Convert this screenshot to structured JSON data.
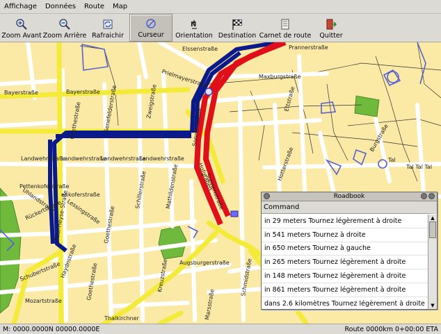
{
  "menu": [
    "Affichage",
    "Données",
    "Route",
    "Map"
  ],
  "toolbar": [
    {
      "label": "Zoom Avant",
      "icon": "zoom-in-icon"
    },
    {
      "label": "Zoom Arrière",
      "icon": "zoom-out-icon"
    },
    {
      "label": "Rafraichir",
      "icon": "refresh-icon"
    },
    {
      "label": "Curseur",
      "icon": "cursor-icon"
    },
    {
      "label": "Orientation",
      "icon": "compass-icon"
    },
    {
      "label": "Destination",
      "icon": "checkered-flag-icon"
    },
    {
      "label": "Carnet de route",
      "icon": "notebook-icon"
    },
    {
      "label": "Quitter",
      "icon": "exit-icon"
    }
  ],
  "streets": {
    "bayerstrasse_1": "Bayerstraße",
    "bayerstrasse_2": "Bayerstraße",
    "landwehrstrasse_1": "Landwehrstraße",
    "landwehrstrasse_2": "Landwehrstraße",
    "landwehrstrasse_3": "Landwehrstraße",
    "landwehrstrasse_4": "Landwehrstraße",
    "elssenstrasse": "Elssenstraße",
    "prielmayerstrasse": "Prielmayerstraße",
    "maxburgstrasse": "Maxburgstraße",
    "prannerstrasse": "Prannerstraße",
    "ettstrasse": "Ettstraße",
    "goethestrasse_1": "Goethestraße",
    "goethestrasse_2": "Goethestraße",
    "goethestrasse_3": "Goethestraße",
    "senefelderstrasse": "Senefelderstraße",
    "zweigstrasse": "Zweigstraße",
    "schillerstrasse": "Schillerstraße",
    "mathildenstrasse": "Mathildenstraße",
    "pettenkoferstrasse": "Pettenkoferstraße",
    "kenkofer": "enkoferstraße",
    "uhlandstrasse": "Uhlandstraße",
    "paulheysestrasse": "Paul-Heyse-Straße",
    "lessingstrasse": "Lessingstraße",
    "ruckertstrasse": "Rückertstraße",
    "schubertstrasse": "Schubertstraße",
    "haydnstrasse": "Haydnstraße",
    "mozartstrasse": "Mozartstraße",
    "sonnenstrasse_1": "Sonnenstraße",
    "sonnenstrasse_2": "Sonnenstraße",
    "hofgraben": "Hofgraben",
    "augsburgerstrasse": "Augsburgerstraße",
    "hotterstrasse": "Hotterstraße",
    "burgstrasse": "Burgstraße",
    "tal": "Tal",
    "taltaltal": "Tal Tal Tal",
    "kirchenstrasse": "Kreuzstraße",
    "marstrasse": "Marsstraße",
    "schmidstrasse": "Schmidstraße",
    "thalkirchner": "Thalkirchner"
  },
  "roadbook": {
    "title": "Roadbook",
    "column": "Command",
    "rows": [
      "in 29 meters Tournez légèrement à droite",
      "in 541 meters Tournez à droite",
      "in 650 meters Tournez à gauche",
      "in 265 meters Tournez légèrement à droite",
      "in 148 meters Tournez légèrement à droite",
      "in 861 meters Tournez légèrement à droite",
      "dans 2.6 kilomètres Tournez légèrement à droite"
    ]
  },
  "status": {
    "position": "M: 0000.0000N 00000.0000E",
    "route": "Route 0000km  0+00:00 ETA"
  },
  "colors": {
    "route": "#0a1a8a",
    "active_route": "#e0101a",
    "main_road": "#f4ea3a",
    "street": "#ffffff",
    "park": "#6fba3c",
    "land": "#fbe9a6"
  }
}
